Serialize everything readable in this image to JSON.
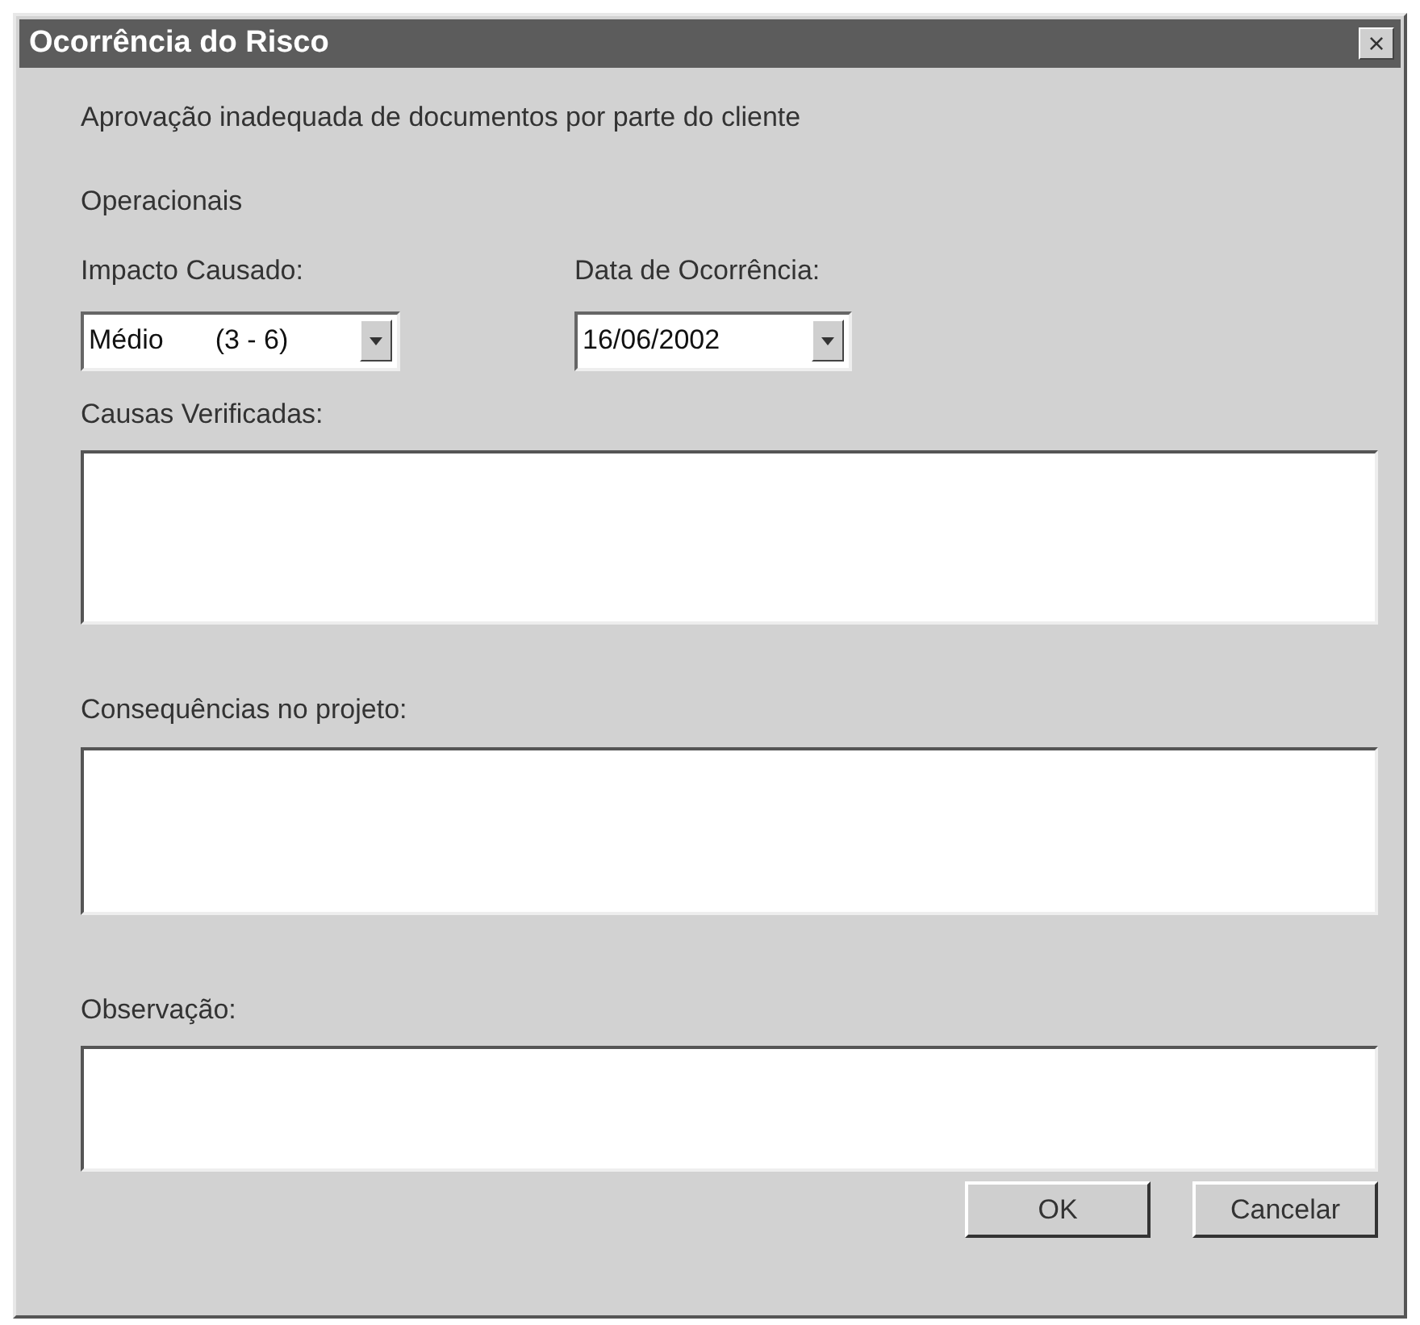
{
  "window": {
    "title": "Ocorrência do Risco",
    "close": "×"
  },
  "description": "Aprovação inadequada de documentos por parte do cliente",
  "category": "Operacionais",
  "impact": {
    "label": "Impacto Causado:",
    "value": "Médio",
    "range": "(3 - 6)"
  },
  "date": {
    "label": "Data de Ocorrência:",
    "value": "16/06/2002"
  },
  "text_areas": [
    {
      "label": "Causas Verificadas:"
    },
    {
      "label": "Consequências no projeto:"
    },
    {
      "label": "Observação:"
    }
  ],
  "buttons": [
    "OK",
    "Cancelar"
  ]
}
